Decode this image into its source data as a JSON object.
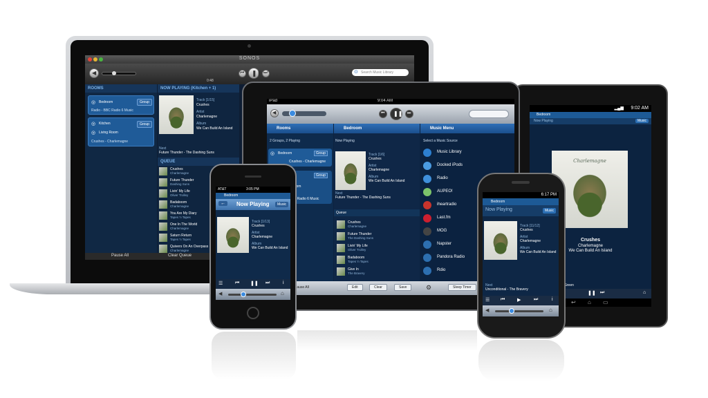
{
  "laptop": {
    "app_title": "SONOS",
    "search_placeholder": "Search Music Library",
    "rooms_header": "ROOMS",
    "now_playing_header": "NOW PLAYING (Kitchen + 1)",
    "group_label": "Group",
    "room1": {
      "name": "Bedroom",
      "source": "Radio - BBC Radio 6 Music"
    },
    "room2": {
      "name1": "Kitchen",
      "name2": "Living Room",
      "source": "Crushes - Charlemagne"
    },
    "track_label": "Track [1/15]",
    "track": "Crushes",
    "artist_label": "Artist",
    "artist": "Charlemagne",
    "album_label": "Album",
    "album": "We Can Build An Island",
    "next_label": "Next",
    "next": "Future Thunder - The Dashing Suns",
    "elapsed": "0:48",
    "queue_header": "QUEUE",
    "queue": [
      {
        "title": "Crushes",
        "sub": "Charlemagne"
      },
      {
        "title": "Future Thunder",
        "sub": "Dashing Suns"
      },
      {
        "title": "Livin' My Life",
        "sub": "Oliver Trolley"
      },
      {
        "title": "Badaboom",
        "sub": "Charlemagne"
      },
      {
        "title": "You Are My Diary",
        "sub": "Tapes 'n Tapes"
      },
      {
        "title": "One In The World",
        "sub": "Charlemagne"
      },
      {
        "title": "Saturn Return",
        "sub": "Tapes 'n Tapes"
      },
      {
        "title": "Quivers On An Overpass",
        "sub": "Charlemagne"
      }
    ],
    "pause_all": "Pause All",
    "clear_queue": "Clear Queue"
  },
  "ipad": {
    "status_left": "iPad",
    "status_time": "9:04 AM",
    "rooms_title": "Rooms",
    "rooms_sub": "2 Groups, 2 Playing",
    "bedroom_title": "Bedroom",
    "now_playing_label": "Now Playing",
    "music_menu_title": "Music Menu",
    "select_source": "Select a Music Source",
    "group_label": "Group",
    "room_a": "Bedroom",
    "room_a_source": "Crushes - Charlemagne",
    "room_b": "room",
    "room_b_source": "BBC Radio 6 Music",
    "track_label": "Track [1/6]",
    "track": "Crushes",
    "artist_label": "Artist",
    "artist": "Charlemagne",
    "album_label": "Album",
    "album": "We Can Build An Island",
    "next_label": "Next",
    "next": "Future Thunder - The Dashing Suns",
    "queue_label": "Queue",
    "queue": [
      {
        "title": "Crushes",
        "sub": "Charlemagne"
      },
      {
        "title": "Future Thunder",
        "sub": "The Dashing Suns"
      },
      {
        "title": "Livin' My Life",
        "sub": "Oliver Trolley"
      },
      {
        "title": "Badaboom",
        "sub": "Tapes 'n Tapes"
      },
      {
        "title": "Give In",
        "sub": "The Bravery"
      }
    ],
    "sources": [
      "Music Library",
      "Docked iPods",
      "Radio",
      "AUPEO!",
      "iheartradio",
      "Last.fm",
      "MOG",
      "Napster",
      "Pandora Radio",
      "Rdio"
    ],
    "pause_all": "Pause All",
    "edit": "Edit",
    "clear": "Clear",
    "save": "Save",
    "sleep_timer": "Sleep Timer",
    "colors": {
      "header_blue": "#2f6fb6",
      "panel_dark": "#0d2340"
    }
  },
  "iphone": {
    "carrier": "AT&T",
    "time": "3:05 PM",
    "room": "Bedroom",
    "title": "Now Playing",
    "music_btn": "Music",
    "track_label": "Track [1/13]",
    "track": "Crushes",
    "artist_label": "Artist",
    "artist": "Charlemagne",
    "album_label": "Album",
    "album": "We Can Build An Island"
  },
  "android_phone": {
    "time": "6:17 PM",
    "room": "Bedroom",
    "title": "Now Playing",
    "music_btn": "Music",
    "track_label": "Track [11/12]",
    "track": "Crushes",
    "artist_label": "Artist",
    "artist": "Charlemagne",
    "album_label": "Album",
    "album": "We Can Build An Island",
    "next_label": "Next",
    "next": "Unconditional - The Bravery"
  },
  "galaxy_tab": {
    "time": "9:02 AM",
    "room": "Bedroom",
    "now_playing": "Now Playing",
    "music_btn": "Music",
    "album_art_text": "Charlemagne",
    "track": "Crushes",
    "artist": "Charlemagne",
    "album": "We Can Build An Island",
    "next_partial": "Green"
  }
}
